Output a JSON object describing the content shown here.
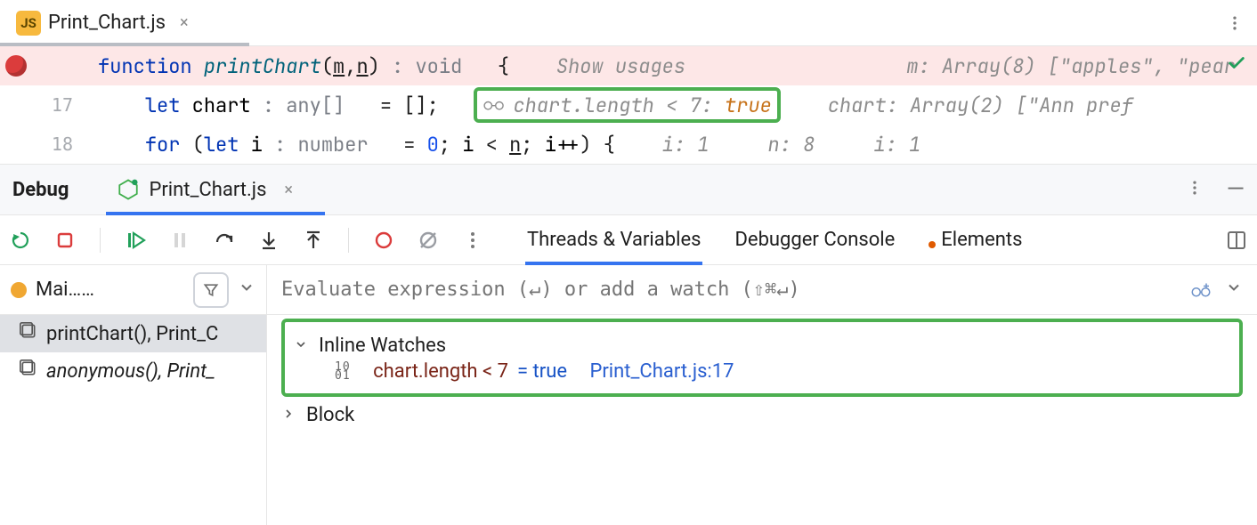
{
  "tab": {
    "badge": "JS",
    "title": "Print_Chart.js"
  },
  "gutter": {
    "line17": "17",
    "line18": "18"
  },
  "code": {
    "l0": {
      "kw": "function",
      "name": "printChart",
      "lp": "(",
      "p1": "m",
      "comma": ",",
      "p2": "n",
      "rp": ")",
      "ret": " : void   ",
      "brace": "{",
      "usages": "Show usages",
      "hint_m": "m: Array(8) [\"apples\", \"pear"
    },
    "l1": {
      "indent": "    ",
      "kw": "let",
      "name": " chart",
      "type": " : any[]   ",
      "eq": "= ",
      "val": "[]",
      "semi": ";",
      "watch": "chart.length < 7:",
      "watch_val": " true",
      "hint_chart": "chart: Array(2) [\"Ann pref"
    },
    "l2": {
      "indent": "    ",
      "kw": "for",
      "lp": " (",
      "kw2": "let",
      "id": " i",
      "type": " : number   ",
      "eq": "= ",
      "zero": "0",
      "semi1": "; ",
      "cond_i": "i",
      "lt": " < ",
      "n": "n",
      "semi2": "; ",
      "inc": "i++",
      "rp": ") ",
      "brace": "{",
      "hints": {
        "i1": "i: 1",
        "n": "n: 8",
        "i2": "i: 1"
      }
    }
  },
  "debug": {
    "title": "Debug",
    "run_tab": "Print_Chart.js"
  },
  "dbg_tabs": {
    "tv": "Threads & Variables",
    "dc": "Debugger Console",
    "el": "Elements"
  },
  "frames": {
    "thread": "Mai……",
    "items": [
      {
        "label": "printChart(), Print_C"
      },
      {
        "label": "anonymous(), Print_"
      }
    ]
  },
  "eval": {
    "placeholder": "Evaluate expression (↵) or add a watch (⇧⌘↵)"
  },
  "watches": {
    "header": "Inline Watches",
    "bits": "10\n01",
    "expr": "chart.length < 7",
    "eqtrue": " = true",
    "src": "Print_Chart.js:17",
    "block": "Block"
  }
}
